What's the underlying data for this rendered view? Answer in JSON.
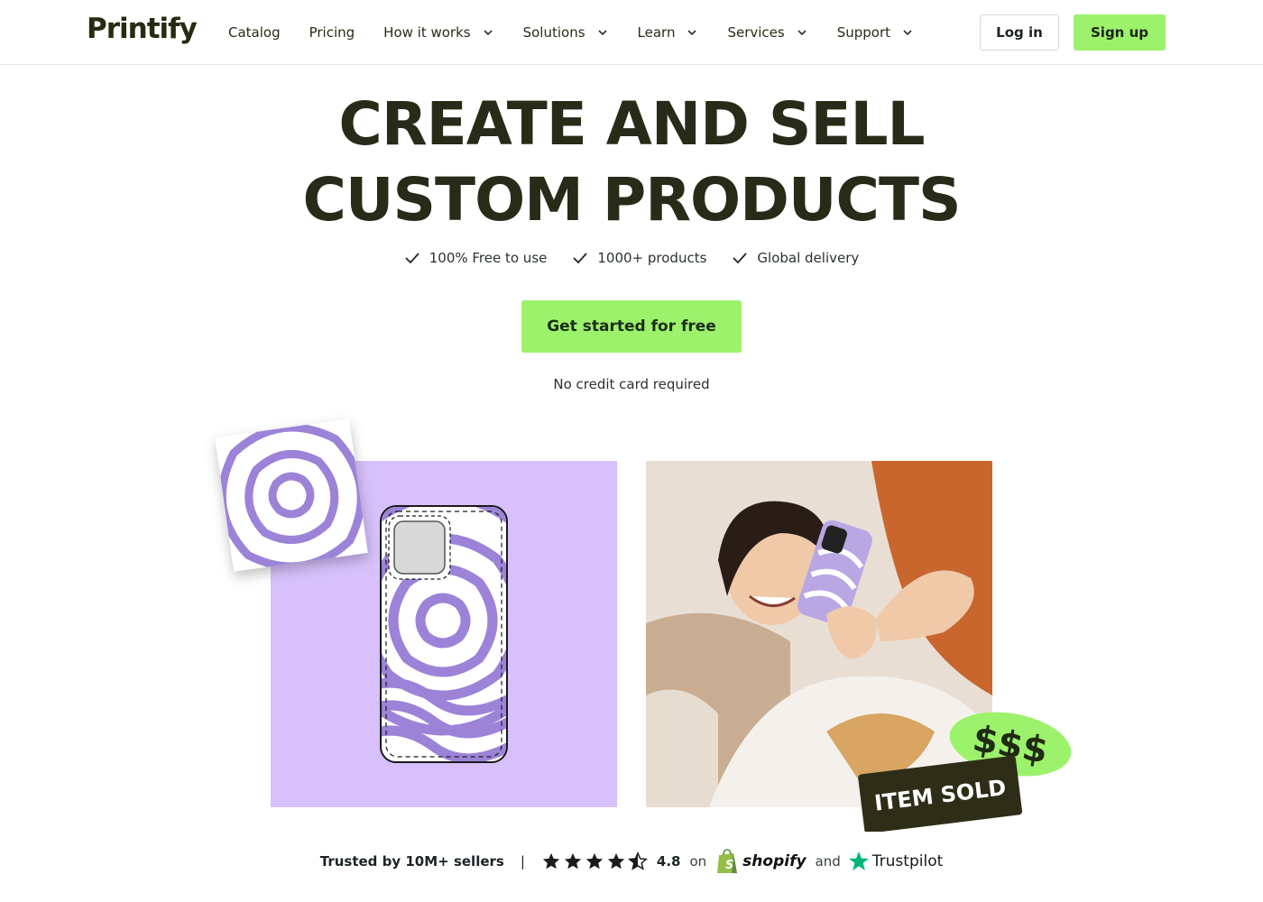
{
  "brand": {
    "logo_text": "Printify",
    "accent_green": "#9cf26a",
    "dark": "#272b17",
    "lavender": "#d7c0fb",
    "purple": "#9c83d8"
  },
  "nav": {
    "items": [
      {
        "label": "Catalog",
        "has_dropdown": false
      },
      {
        "label": "Pricing",
        "has_dropdown": false
      },
      {
        "label": "How it works",
        "has_dropdown": true
      },
      {
        "label": "Solutions",
        "has_dropdown": true
      },
      {
        "label": "Learn",
        "has_dropdown": true
      },
      {
        "label": "Services",
        "has_dropdown": true
      },
      {
        "label": "Support",
        "has_dropdown": true
      }
    ],
    "login_label": "Log in",
    "signup_label": "Sign up"
  },
  "hero": {
    "title_line1": "CREATE AND SELL",
    "title_line2": "CUSTOM PRODUCTS",
    "features": [
      "100% Free to use",
      "1000+ products",
      "Global delivery"
    ],
    "cta_label": "Get started for free",
    "subtext": "No credit card required"
  },
  "visuals": {
    "badge_money": "$$$",
    "badge_sold": "ITEM SOLD"
  },
  "trust": {
    "sellers_text": "Trusted by 10M+ sellers",
    "separator": "|",
    "rating": "4.8",
    "on_text": "on",
    "shopify_text": "shopify",
    "and_text": "and",
    "trustpilot_text": "Trustpilot",
    "stars": 4.5
  }
}
